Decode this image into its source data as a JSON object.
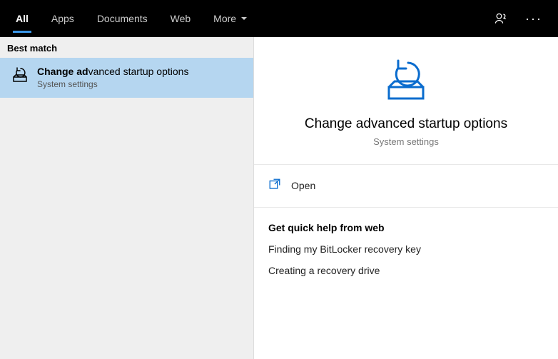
{
  "topbar": {
    "tabs": [
      {
        "label": "All",
        "active": true
      },
      {
        "label": "Apps",
        "active": false
      },
      {
        "label": "Documents",
        "active": false
      },
      {
        "label": "Web",
        "active": false
      },
      {
        "label": "More",
        "active": false,
        "hasDropdown": true
      }
    ]
  },
  "left": {
    "section_label": "Best match",
    "result": {
      "title_bold": "Change ad",
      "title_rest": "vanced startup options",
      "subtitle": "System settings"
    }
  },
  "preview": {
    "title": "Change advanced startup options",
    "subtitle": "System settings",
    "open_label": "Open"
  },
  "help": {
    "header": "Get quick help from web",
    "links": [
      "Finding my BitLocker recovery key",
      "Creating a recovery drive"
    ]
  }
}
